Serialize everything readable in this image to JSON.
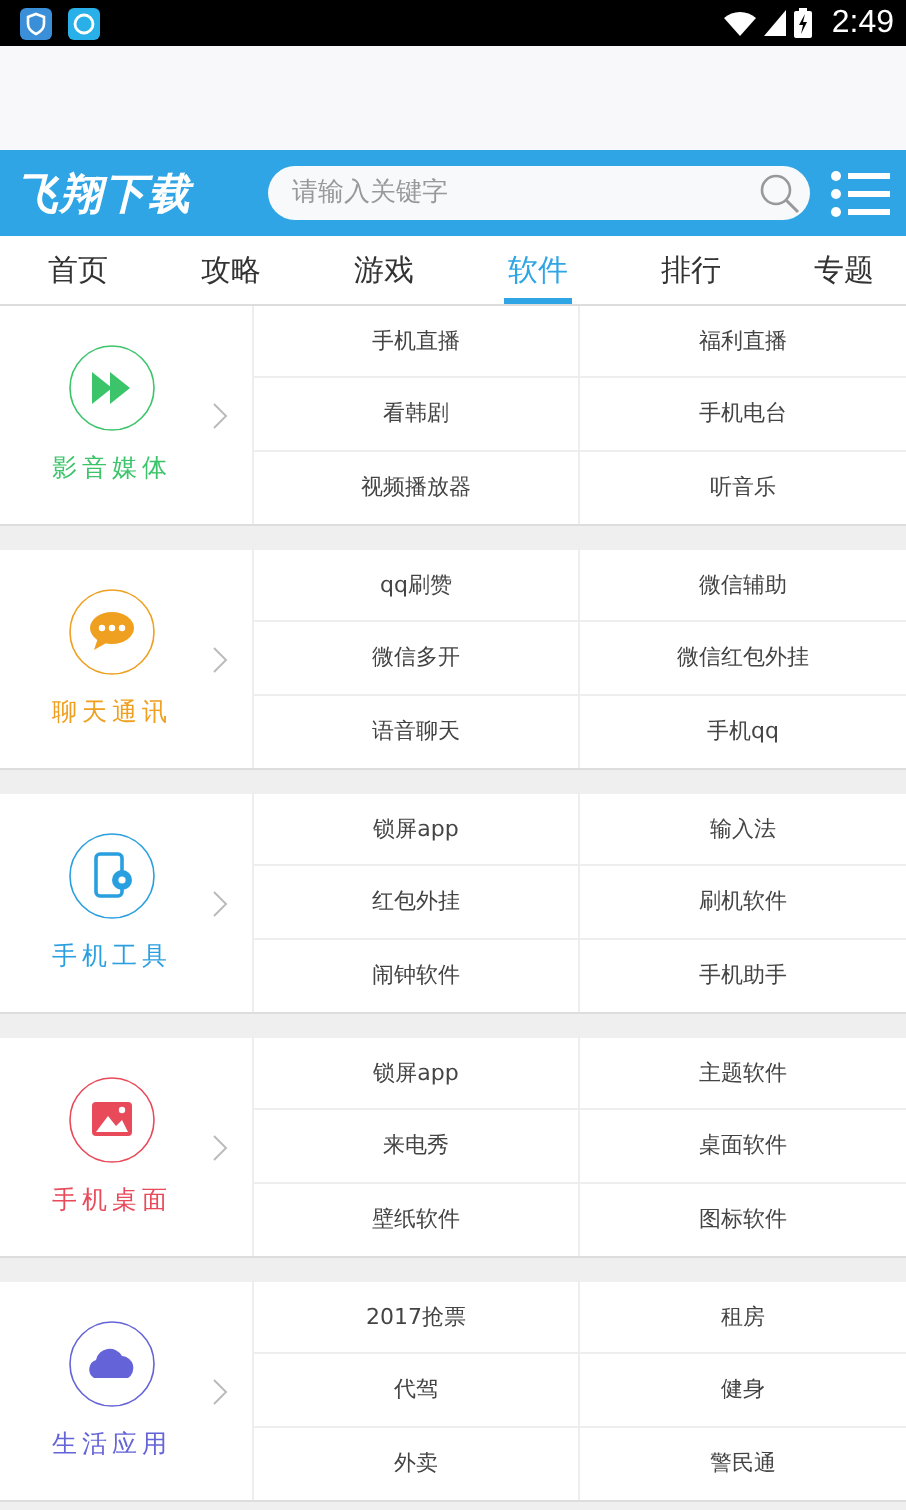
{
  "status_bar": {
    "time": "2:49"
  },
  "header": {
    "logo": "飞翔下载",
    "search": {
      "placeholder": "请输入关键字"
    }
  },
  "tabs": [
    {
      "label": "首页",
      "selected": false
    },
    {
      "label": "攻略",
      "selected": false
    },
    {
      "label": "游戏",
      "selected": false
    },
    {
      "label": "软件",
      "selected": true
    },
    {
      "label": "排行",
      "selected": false
    },
    {
      "label": "专题",
      "selected": false
    }
  ],
  "categories": [
    {
      "kind": "media",
      "name": "影音媒体",
      "color": "#3cc46a",
      "items": [
        "手机直播",
        "福利直播",
        "看韩剧",
        "手机电台",
        "视频播放器",
        "听音乐"
      ]
    },
    {
      "kind": "chat",
      "name": "聊天通讯",
      "color": "#f0a020",
      "items": [
        "qq刷赞",
        "微信辅助",
        "微信多开",
        "微信红包外挂",
        "语音聊天",
        "手机qq"
      ]
    },
    {
      "kind": "tool",
      "name": "手机工具",
      "color": "#2a9fe0",
      "items": [
        "锁屏app",
        "输入法",
        "红包外挂",
        "刷机软件",
        "闹钟软件",
        "手机助手"
      ]
    },
    {
      "kind": "desktop",
      "name": "手机桌面",
      "color": "#e84a5a",
      "items": [
        "锁屏app",
        "主题软件",
        "来电秀",
        "桌面软件",
        "壁纸软件",
        "图标软件"
      ]
    },
    {
      "kind": "cloud",
      "name": "生活应用",
      "color": "#6464d8",
      "items": [
        "2017抢票",
        "租房",
        "代驾",
        "健身",
        "外卖",
        "警民通"
      ]
    }
  ]
}
